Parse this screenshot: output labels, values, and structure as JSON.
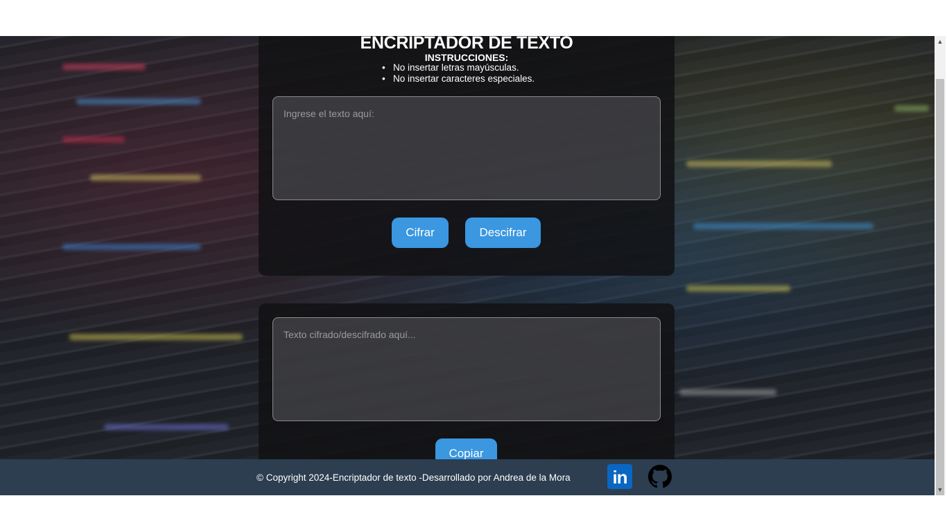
{
  "header": {
    "title": "ENCRIPTADOR DE TEXTO",
    "instructions_title": "INSTRUCCIONES:",
    "instructions": [
      "No insertar letras mayúsculas.",
      "No insertar caracteres especiales."
    ]
  },
  "input": {
    "placeholder": "Ingrese el texto aquí:",
    "value": ""
  },
  "buttons": {
    "encrypt_label": "Cifrar",
    "decrypt_label": "Descifrar",
    "copy_label": "Copiar"
  },
  "output": {
    "placeholder": "Texto cifrado/descifrado aquí...",
    "value": ""
  },
  "footer": {
    "copyright": "© Copyright 2024-Encriptador de texto -Desarrollado por Andrea de la Mora",
    "linkedin_text": "in",
    "linkedin_icon": "linkedin-icon",
    "github_icon": "github-icon"
  },
  "colors": {
    "accent": "#3a97e0",
    "footer_bg": "#2c3e50",
    "linkedin": "#0a66c2"
  }
}
